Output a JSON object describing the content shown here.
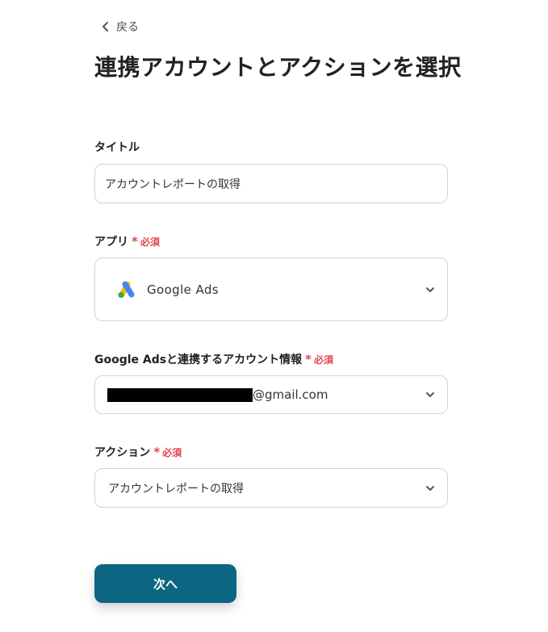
{
  "nav": {
    "back_label": "戻る"
  },
  "page_title": "連携アカウントとアクションを選択",
  "form": {
    "title": {
      "label": "タイトル",
      "value": "アカウントレポートの取得"
    },
    "app": {
      "label": "アプリ",
      "required_label": "必須",
      "value": "Google Ads",
      "icon": "google-ads-logo"
    },
    "account": {
      "label": "Google Adsと連携するアカウント情報",
      "required_label": "必須",
      "value_suffix": "@gmail.com"
    },
    "action": {
      "label": "アクション",
      "required_label": "必須",
      "value": "アカウントレポートの取得"
    },
    "required_marker": "*"
  },
  "footer": {
    "next_label": "次へ"
  },
  "colors": {
    "primary": "#0d6681",
    "required": "#e2434f",
    "border": "#d3d3d3"
  }
}
